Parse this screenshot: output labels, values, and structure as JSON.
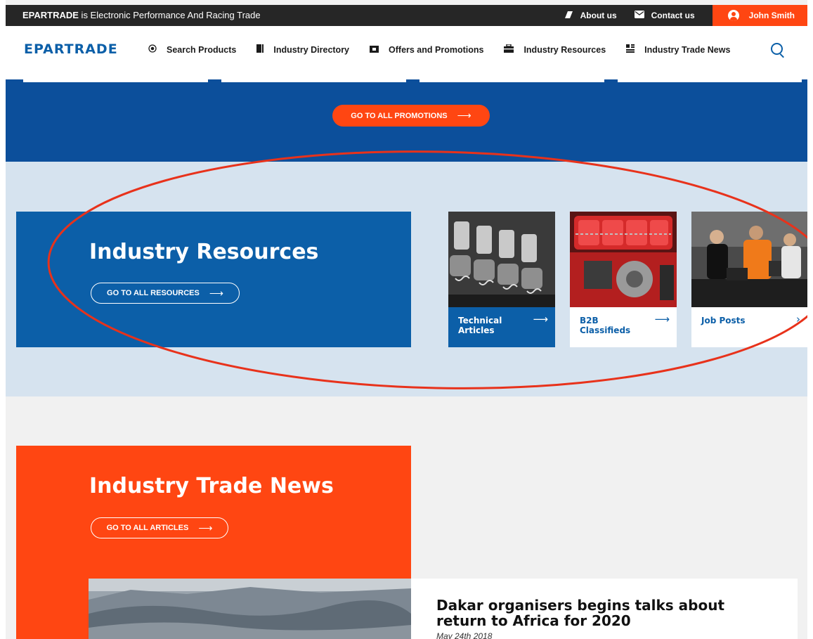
{
  "topbar": {
    "brand": "EPARTRADE",
    "tagline_rest": " is Electronic Performance And Racing Trade",
    "about_label": "About us",
    "contact_label": "Contact us",
    "user_name": "John Smith"
  },
  "nav": {
    "logo": "EPARTRADE",
    "items": [
      {
        "label": "Search Products",
        "icon": "target-icon"
      },
      {
        "label": "Industry Directory",
        "icon": "book-icon"
      },
      {
        "label": "Offers and Promotions",
        "icon": "ticket-icon"
      },
      {
        "label": "Industry Resources",
        "icon": "toolbox-icon"
      },
      {
        "label": "Industry Trade News",
        "icon": "newspaper-icon"
      }
    ],
    "search_icon": "search-icon"
  },
  "promotions": {
    "button_label": "GO TO ALL PROMOTIONS",
    "arrow": "⟶"
  },
  "resources": {
    "title": "Industry Resources",
    "button_label": "GO TO ALL RESOURCES",
    "arrow": "⟶",
    "cards": [
      {
        "label": "Technical Articles",
        "arrow": "⟶"
      },
      {
        "label": "B2B Classifieds",
        "arrow": "⟶"
      },
      {
        "label": "Job Posts",
        "arrow": "›"
      }
    ]
  },
  "news": {
    "title": "Industry Trade News",
    "button_label": "GO TO ALL ARTICLES",
    "arrow": "⟶",
    "article_title": "Dakar organisers begins talks about return to Africa for 2020",
    "article_date": "May 24th 2018"
  },
  "colors": {
    "brand_blue": "#0c5fa8",
    "brand_orange": "#ff4612",
    "annotation_red": "#e8321b",
    "topbar_bg": "#262626"
  }
}
